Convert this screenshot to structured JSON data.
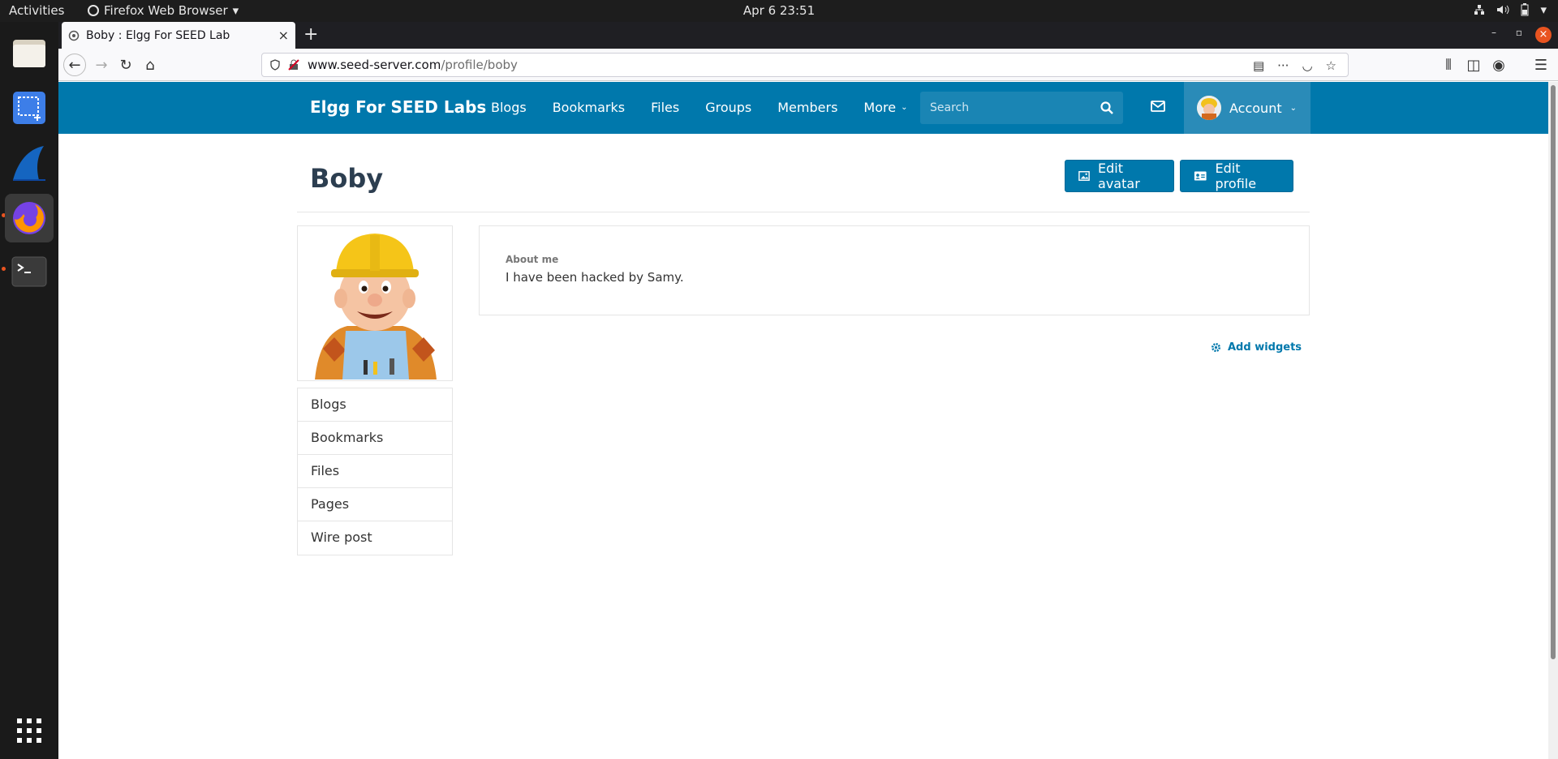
{
  "topbar": {
    "activities": "Activities",
    "app_name": "Firefox Web Browser",
    "clock": "Apr 6  23:51"
  },
  "browser": {
    "tab_title": "Boby : Elgg For SEED Lab",
    "url_host": "www.seed-server.com",
    "url_path": "/profile/boby"
  },
  "site": {
    "brand": "Elgg For SEED Labs",
    "menu": [
      "Blogs",
      "Bookmarks",
      "Files",
      "Groups",
      "Members",
      "More"
    ],
    "search_placeholder": "Search",
    "account_label": "Account"
  },
  "profile": {
    "title": "Boby",
    "edit_avatar": "Edit avatar",
    "edit_profile": "Edit profile",
    "about_label": "About me",
    "about_value": "I have been hacked by Samy.",
    "add_widgets": "Add widgets",
    "owner_menu": [
      "Blogs",
      "Bookmarks",
      "Files",
      "Pages",
      "Wire post"
    ]
  },
  "colors": {
    "elgg_blue": "#0078ac",
    "title_color": "#2c3e50"
  }
}
